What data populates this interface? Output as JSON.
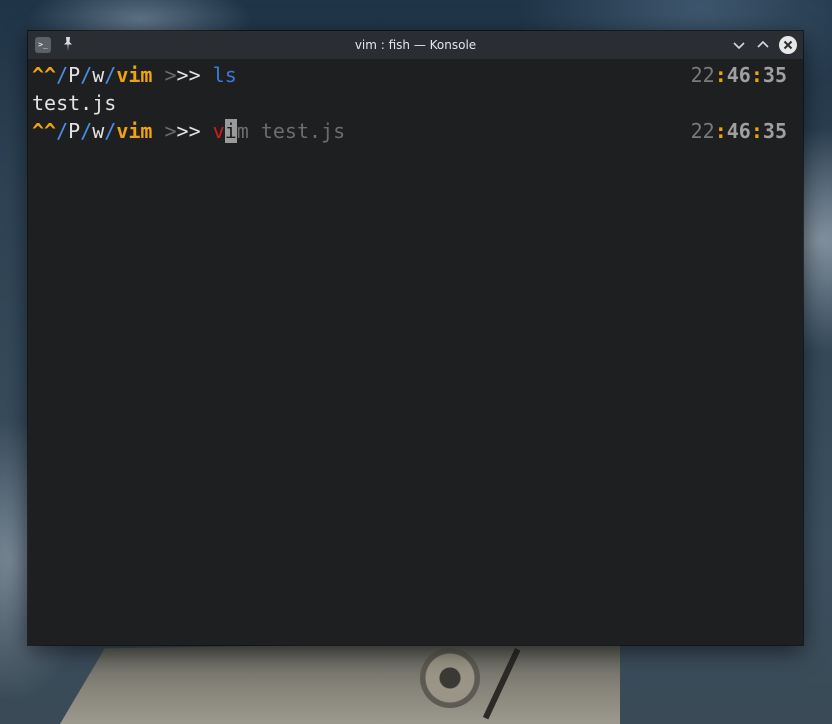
{
  "window": {
    "title": "vim : fish — Konsole",
    "icons": {
      "app": "terminal-icon",
      "pin": "pin-icon",
      "minimize": "chevron-down-icon",
      "maximize": "chevron-up-icon",
      "close": "close-icon"
    },
    "glyphs": {
      "app": ">_",
      "pin": "📌",
      "minimize": "⌄",
      "maximize": "⌃",
      "close": "✕"
    }
  },
  "terminal": {
    "lines": [
      {
        "prompt": {
          "caret": "^^",
          "sep1": "/",
          "p1": "P",
          "sep2": "/",
          "p2": "w",
          "sep3": "/",
          "cwd": "vim",
          "sym_a": " >",
          "sym_b": ">> "
        },
        "command": "ls",
        "time": {
          "hours": "22",
          "colon1": ":",
          "minutes": "46",
          "colon2": ":",
          "seconds": "35"
        }
      },
      {
        "output": "test.js"
      },
      {
        "prompt": {
          "caret": "^^",
          "sep1": "/",
          "p1": "P",
          "sep2": "/",
          "p2": "w",
          "sep3": "/",
          "cwd": "vim",
          "sym_a": " >",
          "sym_b": ">> "
        },
        "typed": "v",
        "cursor_char": "i",
        "suggestion": "m test.js",
        "time": {
          "hours": "22",
          "colon1": ":",
          "minutes": "46",
          "colon2": ":",
          "seconds": "35"
        }
      }
    ]
  },
  "colors": {
    "prompt_accent": "#f0a30a",
    "path_separator": "#4a90e2",
    "command_ok": "#3b7bd8",
    "command_error": "#d41b1b",
    "terminal_bg": "#1e1f21"
  }
}
